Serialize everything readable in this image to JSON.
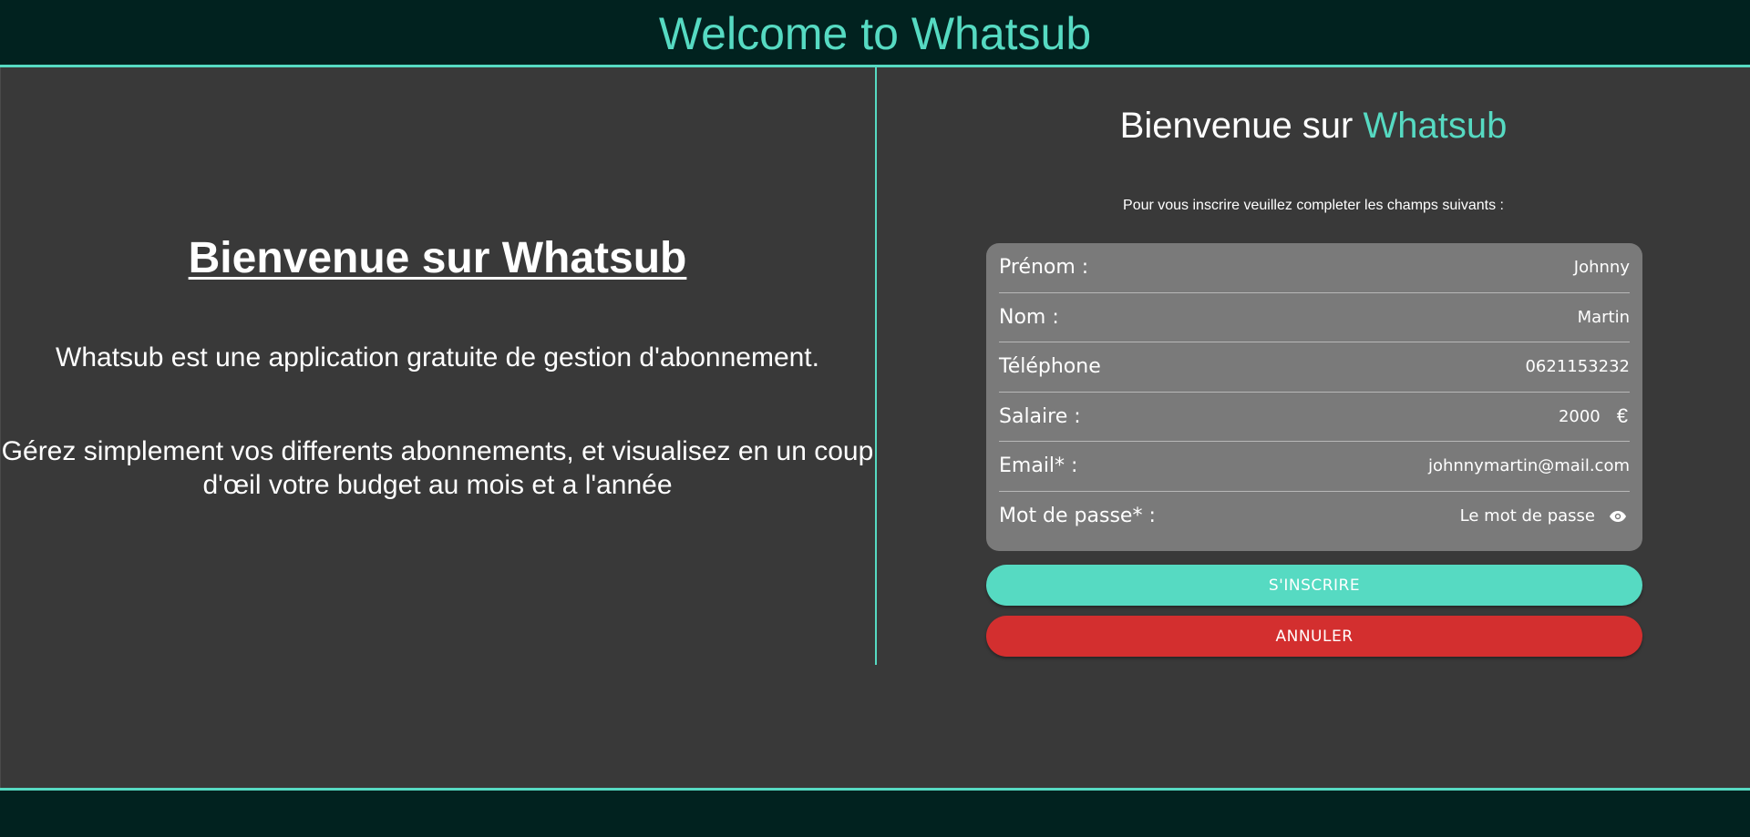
{
  "header": {
    "title": "Welcome to Whatsub"
  },
  "intro": {
    "heading": "Bienvenue sur Whatsub",
    "paragraph1": "Whatsub est une application gratuite de gestion d'abonnement.",
    "paragraph2": "Gérez simplement vos differents abonnements, et visualisez en un coup d'œil votre budget au mois et a l'année"
  },
  "form": {
    "title_prefix": "Bienvenue sur ",
    "title_accent": "Whatsub",
    "instructions": "Pour vous inscrire veuillez completer les champs suivants :",
    "fields": [
      {
        "label": "Prénom :",
        "value": "Johnny"
      },
      {
        "label": "Nom :",
        "value": "Martin"
      },
      {
        "label": "Téléphone",
        "value": "0621153232"
      },
      {
        "label": "Salaire :",
        "value": "2000",
        "suffix": "€"
      },
      {
        "label": "Email* :",
        "value": "johnnymartin@mail.com"
      },
      {
        "label": "Mot de passe* :",
        "value": "Le mot de passe",
        "icon": "eye-icon"
      }
    ],
    "submit_label": "S'INSCRIRE",
    "cancel_label": "ANNULER"
  },
  "colors": {
    "accent": "#56dac2",
    "header_bg": "#01221f",
    "page_bg": "#393939",
    "card_bg": "#7a7a7a",
    "cancel": "#d32f2f"
  }
}
